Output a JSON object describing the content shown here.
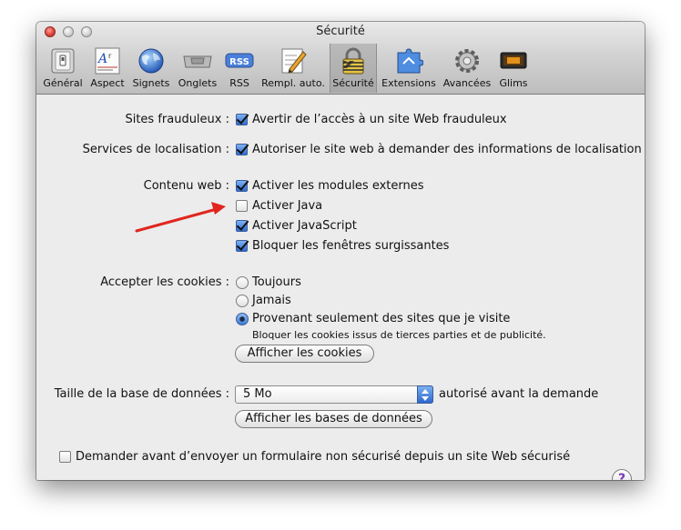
{
  "window": {
    "title": "Sécurité"
  },
  "toolbar": {
    "items": [
      {
        "label": "Général",
        "icon": "switch-icon"
      },
      {
        "label": "Aspect",
        "icon": "font-aspect-icon"
      },
      {
        "label": "Signets",
        "icon": "globe-icon"
      },
      {
        "label": "Onglets",
        "icon": "tabs-icon"
      },
      {
        "label": "RSS",
        "icon": "rss-icon"
      },
      {
        "label": "Rempl. auto.",
        "icon": "pencil-form-icon"
      },
      {
        "label": "Sécurité",
        "icon": "padlock-icon",
        "selected": true
      },
      {
        "label": "Extensions",
        "icon": "puzzle-icon"
      },
      {
        "label": "Avancées",
        "icon": "gear-icon"
      },
      {
        "label": "Glims",
        "icon": "glims-icon"
      }
    ]
  },
  "security": {
    "fraud_label": "Sites frauduleux :",
    "fraud_option": "Avertir de l’accès à un site Web frauduleux",
    "location_label": "Services de localisation :",
    "location_option": "Autoriser le site web à demander des informations de localisation",
    "web_content_label": "Contenu web :",
    "web_options": [
      {
        "label": "Activer les modules externes",
        "checked": true
      },
      {
        "label": "Activer Java",
        "checked": false
      },
      {
        "label": "Activer JavaScript",
        "checked": true
      },
      {
        "label": "Bloquer les fenêtres surgissantes",
        "checked": true
      }
    ],
    "cookies_label": "Accepter les cookies :",
    "cookie_options": [
      {
        "label": "Toujours",
        "selected": false
      },
      {
        "label": "Jamais",
        "selected": false
      },
      {
        "label": "Provenant seulement des sites que je visite",
        "selected": true
      }
    ],
    "cookie_note": "Bloquer les cookies issus de tierces parties et de publicité.",
    "show_cookies_button": "Afficher les cookies",
    "db_size_label": "Taille de la base de données :",
    "db_size_value": "5 Mo",
    "db_size_suffix": "autorisé avant la demande",
    "show_databases_button": "Afficher les bases de données",
    "insecure_form_option": "Demander avant d’envoyer un formulaire non sécurisé depuis un site Web sécurisé",
    "help_label": "?"
  },
  "colors": {
    "arrow": "#e0261f",
    "accent": "#3a74d6",
    "help": "#7a39b5"
  }
}
